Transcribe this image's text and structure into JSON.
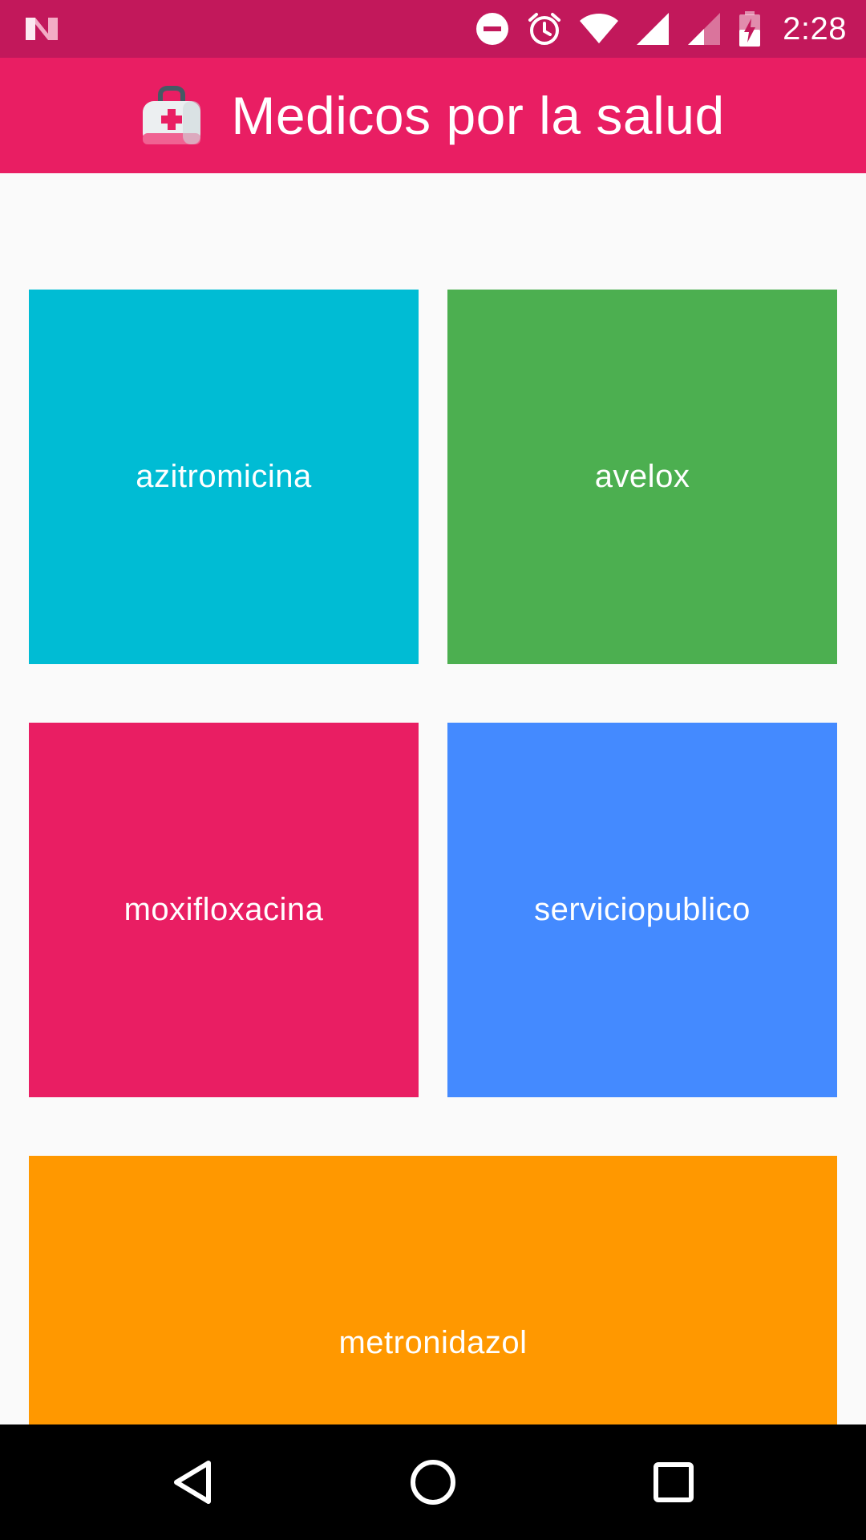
{
  "status_bar": {
    "time": "2:28",
    "icons": [
      "notification-n-icon",
      "do-not-disturb-icon",
      "alarm-icon",
      "wifi-icon",
      "cell-signal-icon",
      "cell-signal-secondary-icon",
      "battery-charging-icon"
    ]
  },
  "app_bar": {
    "title": "Medicos por la salud",
    "icon": "first-aid-kit-icon"
  },
  "tiles": [
    {
      "label": "azitromicina",
      "color": "#00BCD4"
    },
    {
      "label": "avelox",
      "color": "#4CAF50"
    },
    {
      "label": "moxifloxacina",
      "color": "#E91E63"
    },
    {
      "label": "serviciopublico",
      "color": "#448AFF"
    },
    {
      "label": "metronidazol",
      "color": "#FF9800"
    }
  ],
  "nav_bar": {
    "buttons": [
      "back-icon",
      "home-icon",
      "recents-icon"
    ]
  },
  "colors": {
    "status_bar": "#C2185B",
    "app_bar": "#E91E63",
    "background": "#FAFAFA",
    "nav_bar": "#000000"
  }
}
